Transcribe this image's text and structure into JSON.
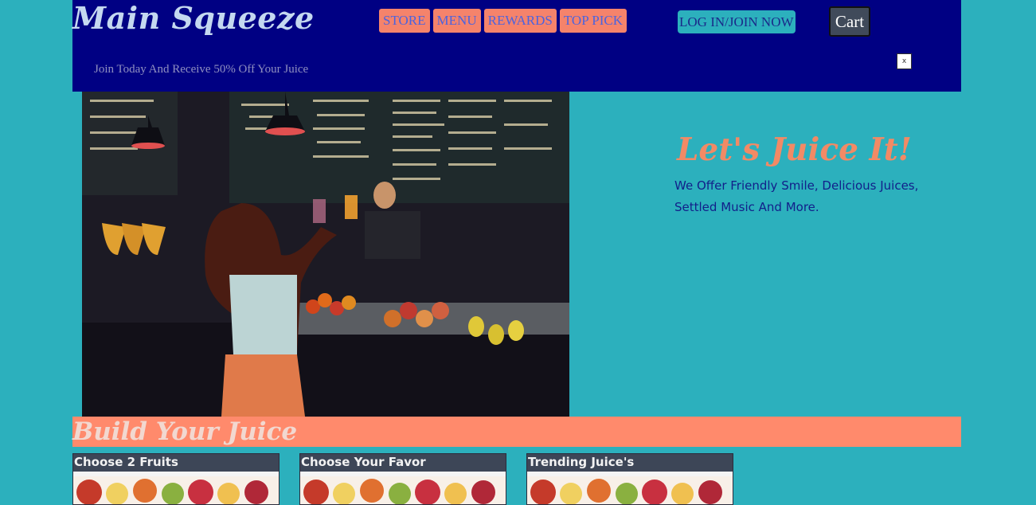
{
  "brand": {
    "name": "Main Squeeze"
  },
  "nav": {
    "items": [
      {
        "label": "STORE"
      },
      {
        "label": "MENU"
      },
      {
        "label": "REWARDS"
      },
      {
        "label": "TOP PICK"
      }
    ]
  },
  "login_label": "LOG IN/JOIN NOW",
  "cart_label": "Cart",
  "promo_text": "Join Today And Receive 50% Off Your Juice",
  "close_label": "x",
  "hero": {
    "tagline": "Let's Juice It!",
    "subtitle": "We Offer Friendly Smile, Delicious Juices, Settled Music And More."
  },
  "build": {
    "title": "Build Your Juice"
  },
  "cards": [
    {
      "title": "Choose 2 Fruits"
    },
    {
      "title": "Choose Your Favor"
    },
    {
      "title": "Trending Juice's"
    }
  ],
  "colors": {
    "header_bg": "#000083",
    "page_bg": "#2cb0bd",
    "accent": "#f5836b",
    "build_bar": "#ff8a6c"
  }
}
